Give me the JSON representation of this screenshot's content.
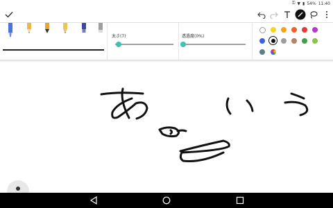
{
  "status": {
    "battery": "54%",
    "time": "11:40"
  },
  "toolbar": {
    "done_icon": "checkmark-icon",
    "undo_icon": "undo-icon",
    "redo_icon": "redo-icon",
    "text_icon": "text-tool-icon",
    "pen_icon": "pen-tool-icon",
    "lasso_icon": "lasso-icon",
    "more_icon": "more-vert-icon"
  },
  "pens": [
    {
      "name": "fountain-pen",
      "color": "#4a74d8"
    },
    {
      "name": "pencil",
      "color": "#e9b84a"
    },
    {
      "name": "brush",
      "color": "#e9a23a"
    },
    {
      "name": "highlighter",
      "color": "#e9c84a"
    },
    {
      "name": "marker",
      "color": "#3a4aa0"
    },
    {
      "name": "eraser",
      "color": "#9e9e9e"
    }
  ],
  "sliders": {
    "thickness": {
      "label": "太さ(7)",
      "value": 7
    },
    "opacity": {
      "label": "透過度(0%)",
      "value_percent": 0
    }
  },
  "palette": [
    "#ffffff",
    "#f7d51e",
    "#f2a31e",
    "#f0622c",
    "#e53935",
    "#b03ac9",
    "#3f5fe0",
    "#111111",
    "#9e9e9e",
    "#b58463",
    "#43a047",
    "#8bc34a",
    "#607d8b",
    "rainbow"
  ],
  "selected_color_index": 7,
  "nav": {
    "back_icon": "back-icon",
    "home_icon": "home-icon",
    "recents_icon": "recents-icon"
  }
}
